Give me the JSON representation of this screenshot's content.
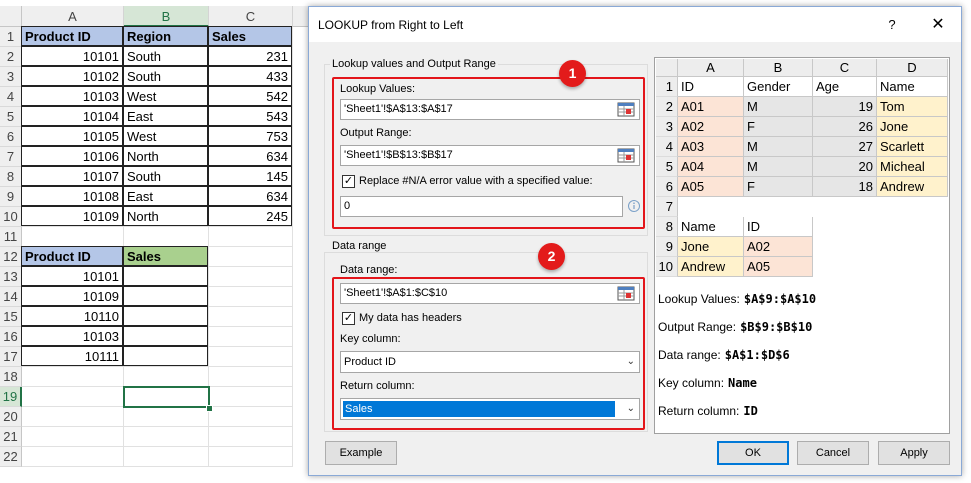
{
  "sheet": {
    "columns": [
      "A",
      "B",
      "C"
    ],
    "rows": [
      "1",
      "2",
      "3",
      "4",
      "5",
      "6",
      "7",
      "8",
      "9",
      "10",
      "11",
      "12",
      "13",
      "14",
      "15",
      "16",
      "17",
      "18",
      "19",
      "20",
      "21",
      "22"
    ],
    "table1": {
      "headers": [
        "Product ID",
        "Region",
        "Sales"
      ],
      "data": [
        [
          "10101",
          "South",
          "231"
        ],
        [
          "10102",
          "South",
          "433"
        ],
        [
          "10103",
          "West",
          "542"
        ],
        [
          "10104",
          "East",
          "543"
        ],
        [
          "10105",
          "West",
          "753"
        ],
        [
          "10106",
          "North",
          "634"
        ],
        [
          "10107",
          "South",
          "145"
        ],
        [
          "10108",
          "East",
          "634"
        ],
        [
          "10109",
          "North",
          "245"
        ]
      ]
    },
    "table2": {
      "headers": [
        "Product ID",
        "Sales"
      ],
      "data": [
        "10101",
        "10109",
        "10110",
        "10103",
        "10111"
      ]
    },
    "colors": {
      "blue_header": "#b4c6e7",
      "green_header": "#a9d08e",
      "selection": "#217346"
    }
  },
  "dialog": {
    "title": "LOOKUP from Right to Left",
    "help": "?",
    "close": "✕",
    "group1": {
      "legend": "Lookup values and Output Range",
      "lookup_label": "Lookup Values:",
      "lookup_value": "'Sheet1'!$A$13:$A$17",
      "output_label": "Output Range:",
      "output_value": "'Sheet1'!$B$13:$B$17",
      "replace_label": "Replace #N/A error value with a specified value:",
      "replace_checked": "✓",
      "replace_value": "0"
    },
    "group2": {
      "legend": "Data range",
      "range_label": "Data range:",
      "range_value": "'Sheet1'!$A$1:$C$10",
      "headers_label": "My data has headers",
      "headers_checked": "✓",
      "key_label": "Key column:",
      "key_value": "Product ID",
      "return_label": "Return column:",
      "return_value": "Sales"
    },
    "badges": [
      "1",
      "2"
    ],
    "preview": {
      "columns": [
        "A",
        "B",
        "C",
        "D"
      ],
      "rows": [
        "1",
        "2",
        "3",
        "4",
        "5",
        "6",
        "7",
        "8",
        "9",
        "10"
      ],
      "table1": {
        "headers": [
          "ID",
          "Gender",
          "Age",
          "Name"
        ],
        "data": [
          [
            "A01",
            "M",
            "19",
            "Tom"
          ],
          [
            "A02",
            "F",
            "26",
            "Jone"
          ],
          [
            "A03",
            "M",
            "27",
            "Scarlett"
          ],
          [
            "A04",
            "M",
            "20",
            "Micheal"
          ],
          [
            "A05",
            "F",
            "18",
            "Andrew"
          ]
        ]
      },
      "table2": {
        "headers": [
          "Name",
          "ID"
        ],
        "data": [
          [
            "Jone",
            "A02"
          ],
          [
            "Andrew",
            "A05"
          ]
        ]
      },
      "info": [
        {
          "label": "Lookup Values:",
          "value": "$A$9:$A$10"
        },
        {
          "label": "Output Range:",
          "value": "$B$9:$B$10"
        },
        {
          "label": "Data range:",
          "value": "$A$1:$D$6"
        },
        {
          "label": "Key column:",
          "value": "Name"
        },
        {
          "label": "Return column:",
          "value": "ID"
        }
      ]
    },
    "buttons": {
      "example": "Example",
      "ok": "OK",
      "cancel": "Cancel",
      "apply": "Apply"
    },
    "colors": {
      "red_box": "#e3151a",
      "badge": "#e31b1b",
      "accent": "#0078d7"
    }
  }
}
